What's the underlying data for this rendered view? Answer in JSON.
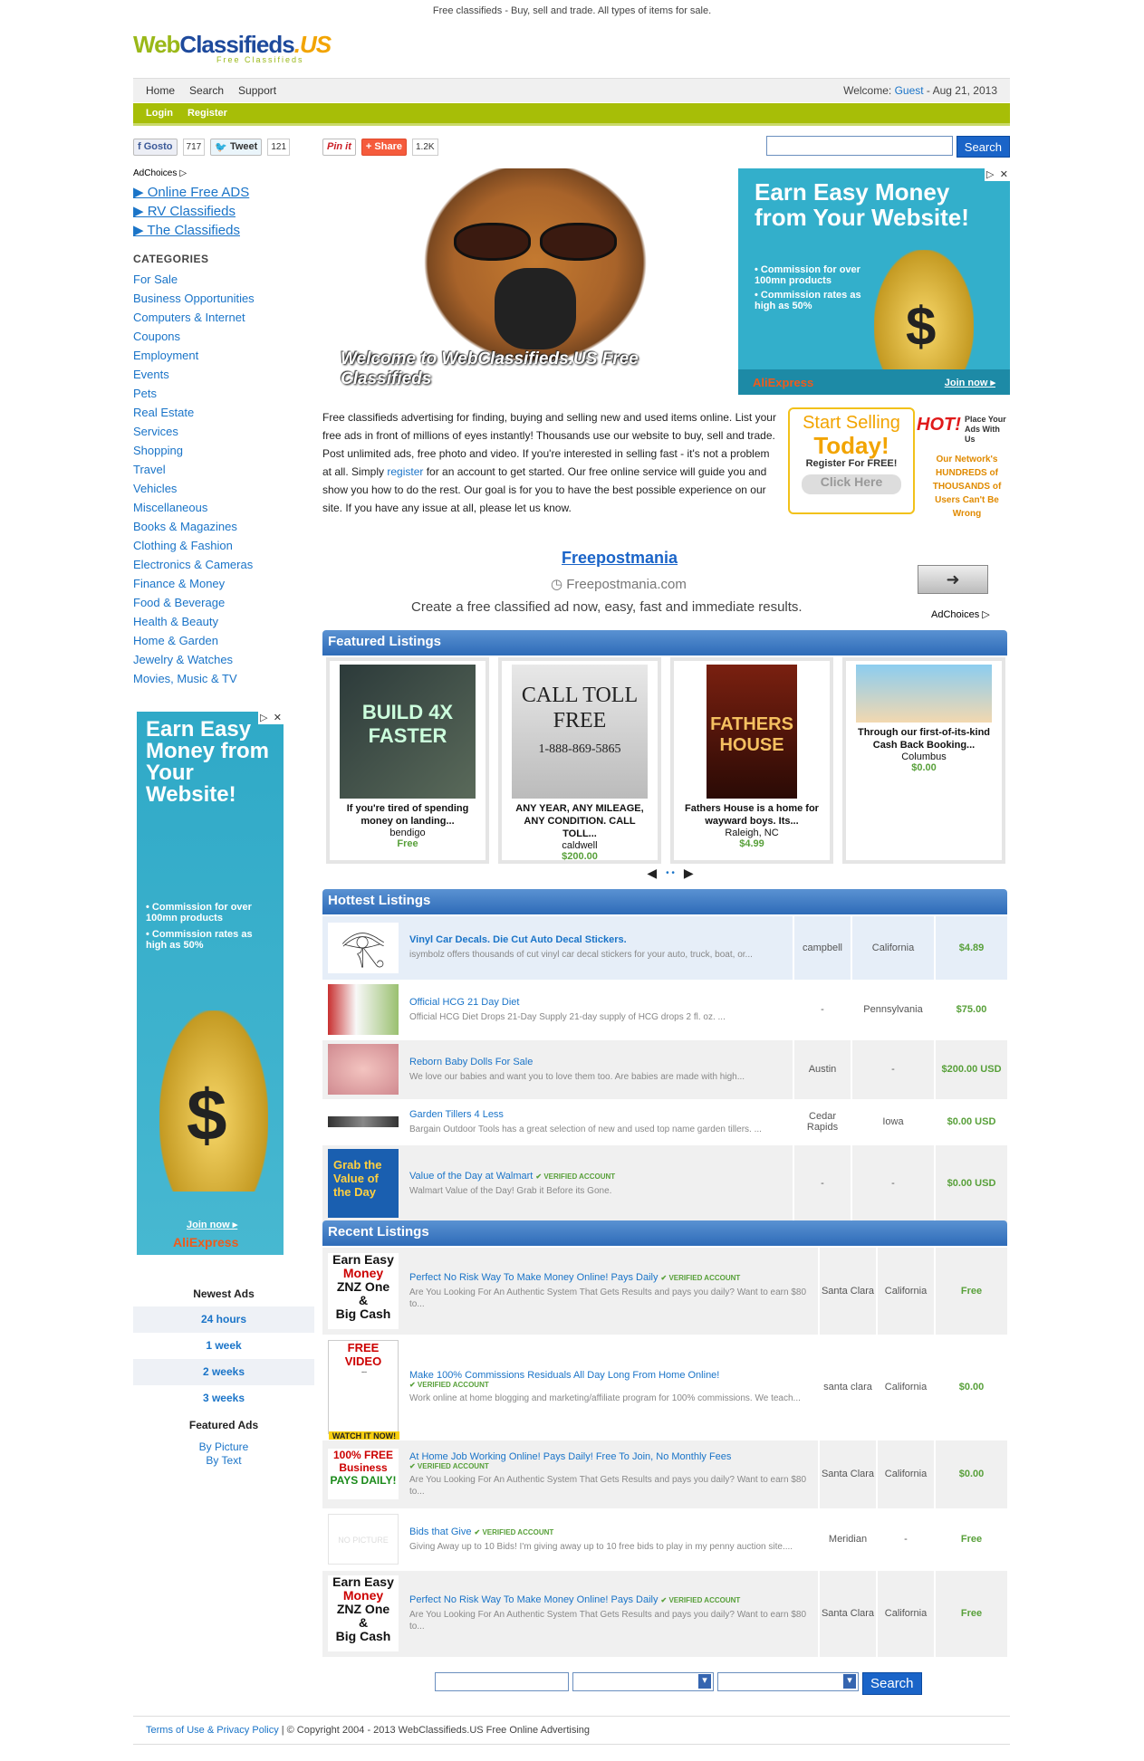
{
  "tagline": "Free classifieds - Buy, sell and trade. All types of items for sale.",
  "logo": {
    "web": "Web",
    "classifieds": "Classifieds",
    "us": ".US",
    "sub": "Free Classifieds"
  },
  "nav": {
    "links": [
      "Home",
      "Search",
      "Support"
    ],
    "welcome_prefix": "Welcome: ",
    "guest": "Guest",
    "date": " - Aug 21, 2013",
    "login": "Login",
    "register": "Register"
  },
  "social": {
    "fb": "Gosto",
    "fb_count": "717",
    "tweet": "Tweet",
    "tweet_count": "121",
    "pin": "Pin it",
    "share": "Share",
    "share_count": "1.2K",
    "search_btn": "Search"
  },
  "sidebar": {
    "adchoices": "AdChoices",
    "sponsored": [
      "▶ Online Free ADS",
      "▶ RV Classifieds",
      "▶ The Classifieds"
    ],
    "categories_title": "CATEGORIES",
    "categories": [
      "For Sale",
      "Business Opportunities",
      "Computers & Internet",
      "Coupons",
      "Employment",
      "Events",
      "Pets",
      "Real Estate",
      "Services",
      "Shopping",
      "Travel",
      "Vehicles",
      "Miscellaneous",
      "Books & Magazines",
      "Clothing & Fashion",
      "Electronics & Cameras",
      "Finance & Money",
      "Food & Beverage",
      "Health & Beauty",
      "Home & Garden",
      "Jewelry & Watches",
      "Movies, Music & TV"
    ],
    "ad": {
      "headline": "Earn Easy Money from Your Website!",
      "b1": "• Commission for over 100mn products",
      "b2": "• Commission rates as high as 50%",
      "join": "Join now ▸",
      "brand": "AliExpress"
    },
    "newest_title": "Newest Ads",
    "newest": [
      "24 hours",
      "1 week",
      "2 weeks",
      "3 weeks"
    ],
    "featured_title": "Featured Ads",
    "featured_links": [
      "By Picture",
      "By Text"
    ]
  },
  "hero": {
    "caption": "Welcome to WebClassifieds.US Free Classifieds"
  },
  "right_ad": {
    "headline": "Earn Easy Money from Your Website!",
    "b1": "• Commission for over 100mn products",
    "b2": "• Commission rates as high as 50%",
    "brand": "AliExpress",
    "join": "Join now ▸"
  },
  "intro": {
    "text1": "Free classifieds advertising for finding, buying and selling new and used items online. List your free ads in front of millions of eyes instantly! Thousands use our website to buy, sell and trade. Post unlimited ads, free photo and video. If you're interested in selling fast - it's not a problem at all. Simply ",
    "link": "register",
    "text2": " for an account to get started. Our free online service will guide you and show you how to do the rest. Our goal is for you to have the best possible experience on our site. If you have any issue at all, please let us know."
  },
  "start_selling": {
    "l1": "Start Selling",
    "l2": "Today!",
    "l3": "Register For FREE!",
    "l4": "Click Here",
    "hot": "HOT!",
    "place": "Place Your Ads With Us",
    "network": "Our Network's HUNDREDS of THOUSANDS of Users Can't Be Wrong"
  },
  "text_ad": {
    "title": "Freepostmania",
    "url": "Freepostmania.com",
    "desc": "Create a free classified ad now, easy, fast and immediate results.",
    "adchoices": "AdChoices"
  },
  "featured": {
    "title": "Featured Listings",
    "items": [
      {
        "text": "If you're tired of spending money on landing...",
        "loc": "bendigo",
        "price": "Free"
      },
      {
        "text": "ANY YEAR, ANY MILEAGE, ANY CONDITION. CALL TOLL...",
        "loc": "caldwell",
        "price": "$200.00"
      },
      {
        "text": "Fathers House is a home for wayward boys. Its...",
        "loc": "Raleigh, NC",
        "price": "$4.99"
      },
      {
        "text": "Through our first-of-its-kind Cash Back Booking...",
        "loc": "Columbus",
        "price": "$0.00"
      }
    ]
  },
  "hottest": {
    "title": "Hottest Listings",
    "rows": [
      {
        "title": "Vinyl Car Decals. Die Cut Auto Decal Stickers.",
        "desc": "isymbolz offers thousands of cut vinyl car decal stickers for your auto, truck, boat, or...",
        "c1": "campbell",
        "c2": "California",
        "price": "$4.89"
      },
      {
        "title": "Official HCG 21 Day Diet",
        "desc": "Official HCG Diet Drops 21-Day Supply 21-day supply of HCG drops 2 fl. oz. ...",
        "c1": "-",
        "c2": "Pennsylvania",
        "price": "$75.00"
      },
      {
        "title": "Reborn Baby Dolls For Sale",
        "desc": "We love our babies and want you to love them too. Are babies are made with high...",
        "c1": "Austin",
        "c2": "-",
        "price": "$200.00 USD"
      },
      {
        "title": "Garden Tillers 4 Less",
        "desc": "Bargain Outdoor Tools has a great selection of new and used top name garden tillers. ...",
        "c1": "Cedar Rapids",
        "c2": "Iowa",
        "price": "$0.00 USD"
      },
      {
        "title": "Value of the Day at Walmart",
        "desc": "Walmart Value of the Day! Grab it Before its Gone.",
        "c1": "-",
        "c2": "-",
        "price": "$0.00 USD"
      }
    ]
  },
  "recent": {
    "title": "Recent Listings",
    "rows": [
      {
        "title": "Perfect No Risk Way To Make Money Online! Pays Daily",
        "desc": "Are You Looking For An Authentic System That Gets Results and pays you daily? Want to earn $80 to...",
        "c1": "Santa Clara",
        "c2": "California",
        "price": "Free"
      },
      {
        "title": "Make 100% Commissions Residuals All Day Long From Home Online!",
        "desc": "Work online at home blogging and marketing/affiliate program for 100% commissions. We teach...",
        "c1": "santa clara",
        "c2": "California",
        "price": "$0.00"
      },
      {
        "title": "At Home Job Working Online! Pays Daily! Free To Join, No Monthly Fees",
        "desc": "Are You Looking For An Authentic System That Gets Results and pays you daily? Want to earn $80 to...",
        "c1": "Santa Clara",
        "c2": "California",
        "price": "$0.00"
      },
      {
        "title": "Bids that Give",
        "desc": "Giving Away up to 10 Bids! I'm giving away up to 10 free bids to play in my penny auction site....",
        "c1": "Meridian",
        "c2": "-",
        "price": "Free"
      },
      {
        "title": "Perfect No Risk Way To Make Money Online! Pays Daily",
        "desc": "Are You Looking For An Authentic System That Gets Results and pays you daily? Want to earn $80 to...",
        "c1": "Santa Clara",
        "c2": "California",
        "price": "Free"
      }
    ]
  },
  "verified": "✔ VERIFIED ACCOUNT",
  "bottom_search": {
    "button": "Search"
  },
  "footer": {
    "link": "Terms of Use & Privacy Policy",
    "text": " | © Copyright 2004 - 2013 WebClassifieds.US Free Online Advertising"
  }
}
